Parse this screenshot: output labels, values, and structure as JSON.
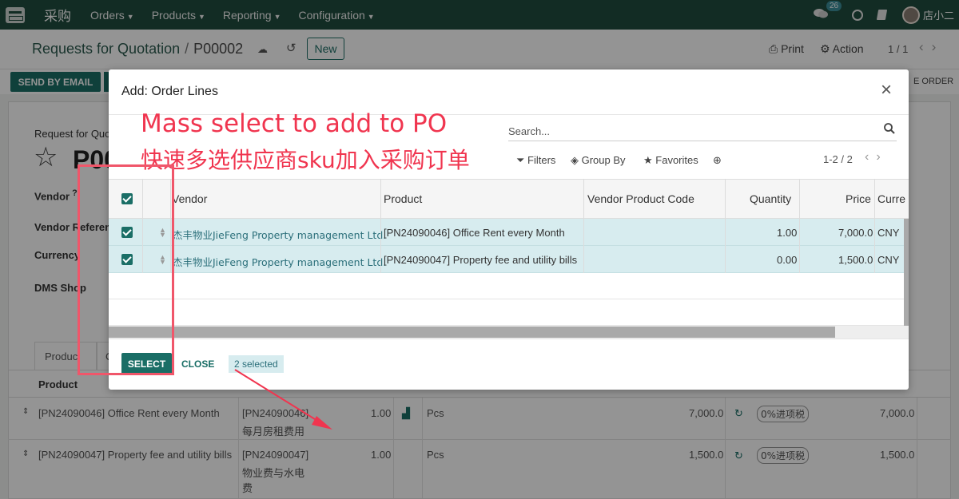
{
  "topnav": {
    "brand": "采购",
    "menus": [
      "Orders",
      "Products",
      "Reporting",
      "Configuration"
    ],
    "chat_count": "26",
    "username": "店小二"
  },
  "control": {
    "breadcrumb_parent": "Requests for Quotation",
    "breadcrumb_current": "P00002",
    "new_label": "New",
    "print_label": "Print",
    "action_label": "Action",
    "pager": "1 / 1"
  },
  "statusbar": {
    "send_email": "SEND BY EMAIL",
    "confirm_order": "E ORDER"
  },
  "form": {
    "rfq_label": "Request for Quo",
    "title": "P00",
    "fields": [
      "Vendor",
      "Vendor Referen",
      "Currency",
      "DMS Shop"
    ],
    "tabs": [
      "Produc",
      "C"
    ],
    "lines_header_product": "Product",
    "lines": [
      {
        "product": "[PN24090046] Office Rent every Month",
        "desc": [
          "[PN24090046]",
          "每月房租费用"
        ],
        "qty": "1.00",
        "uom": "Pcs",
        "price": "7,000.0",
        "tax": "0%进项税",
        "subtotal": "7,000.0"
      },
      {
        "product": "[PN24090047] Property fee and utility bills",
        "desc": [
          "[PN24090047]",
          "物业费与水电",
          "费"
        ],
        "qty": "1.00",
        "uom": "Pcs",
        "price": "1,500.0",
        "tax": "0%进项税",
        "subtotal": "1,500.0"
      }
    ]
  },
  "modal": {
    "title": "Add: Order Lines",
    "search_placeholder": "Search...",
    "filters": "Filters",
    "group_by": "Group By",
    "favorites": "Favorites",
    "pager": "1-2 / 2",
    "columns": [
      "Vendor",
      "Product",
      "Vendor Product Code",
      "Quantity",
      "Price",
      "Curre"
    ],
    "rows": [
      {
        "vendor": "杰丰物业JieFeng Property management Ltd.",
        "product": "[PN24090046] Office Rent every Month",
        "code": "",
        "quantity": "1.00",
        "price": "7,000.0",
        "currency": "CNY"
      },
      {
        "vendor": "杰丰物业JieFeng Property management Ltd.",
        "product": "[PN24090047] Property fee and utility bills",
        "code": "",
        "quantity": "0.00",
        "price": "1,500.0",
        "currency": "CNY"
      }
    ],
    "select_label": "SELECT",
    "close_label": "CLOSE",
    "selected_count": "2 selected"
  },
  "annotation": {
    "english": "Mass select to add to PO",
    "chinese": "快速多选供应商sku加入采购订单",
    "color": "#f0354f"
  }
}
